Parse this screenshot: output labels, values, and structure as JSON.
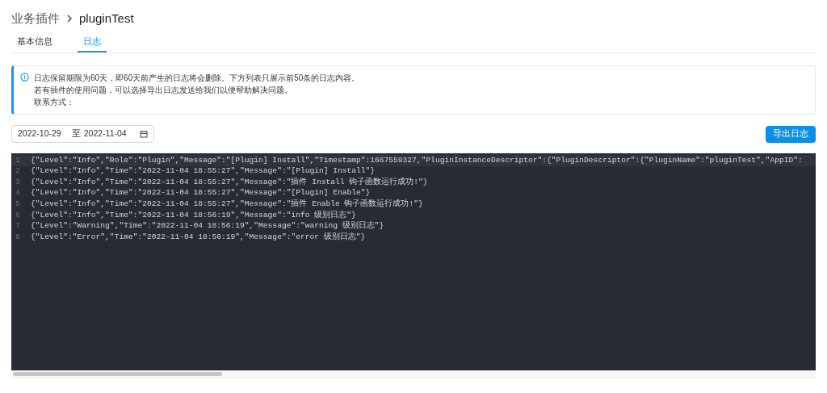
{
  "breadcrumb": {
    "parent": "业务插件",
    "current": "pluginTest"
  },
  "tabs": [
    {
      "label": "基本信息",
      "selected": false
    },
    {
      "label": "日志",
      "selected": true
    }
  ],
  "notice": {
    "lines": [
      "日志保留期限为60天，即60天前产生的日志将会删除。下方列表只展示前50条的日志内容。",
      "若有插件的使用问题，可以选择导出日志发送给我们以便帮助解决问题。",
      "联系方式："
    ]
  },
  "date_range": {
    "start": "2022-10-29",
    "separator": "至",
    "end": "2022-11-04"
  },
  "export_button": "导出日志",
  "log_lines": [
    {
      "number": "1",
      "text": "{\"Level\":\"Info\",\"Role\":\"Plugin\",\"Message\":\"[Plugin] Install\",\"Timestamp\":1667559327,\"PluginInstanceDescriptor\":{\"PluginDescriptor\":{\"PluginName\":\"pluginTest\",\"AppID\":",
      "selected": true
    },
    {
      "number": "2",
      "text": "{\"Level\":\"Info\",\"Time\":\"2022-11-04 18:55:27\",\"Message\":\"[Plugin] Install\"}",
      "selected": false
    },
    {
      "number": "3",
      "text": "{\"Level\":\"Info\",\"Time\":\"2022-11-04 18:55:27\",\"Message\":\"插件 Install 钩子函数运行成功!\"}",
      "selected": false
    },
    {
      "number": "4",
      "text": "{\"Level\":\"Info\",\"Time\":\"2022-11-04 18:55:27\",\"Message\":\"[Plugin] Enable\"}",
      "selected": false
    },
    {
      "number": "5",
      "text": "{\"Level\":\"Info\",\"Time\":\"2022-11-04 18:55:27\",\"Message\":\"插件 Enable 钩子函数运行成功!\"}",
      "selected": false
    },
    {
      "number": "6",
      "text": "{\"Level\":\"Info\",\"Time\":\"2022-11-04 18:56:19\",\"Message\":\"info 级别日志\"}",
      "selected": false
    },
    {
      "number": "7",
      "text": "{\"Level\":\"Warning\",\"Time\":\"2022-11-04 18:56:19\",\"Message\":\"warning 级别日志\"}",
      "selected": false
    },
    {
      "number": "8",
      "text": "{\"Level\":\"Error\",\"Time\":\"2022-11-04 18:56:19\",\"Message\":\"error 级别日志\"}",
      "selected": false
    }
  ]
}
